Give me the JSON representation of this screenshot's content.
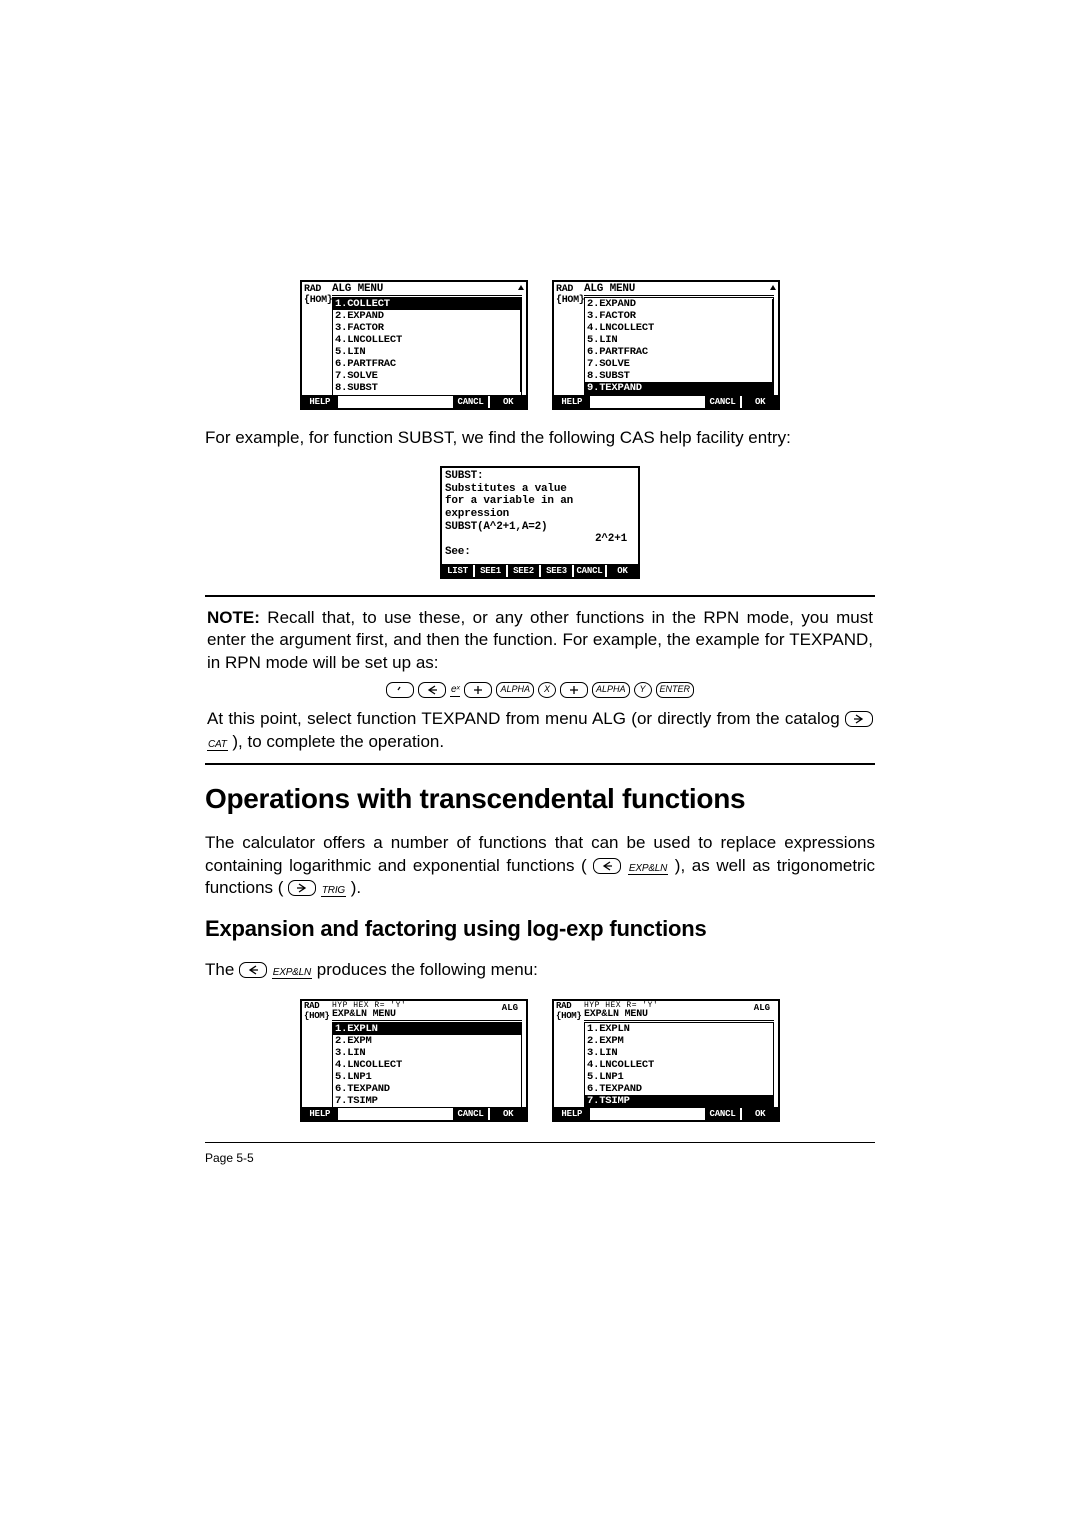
{
  "alg_menu_left": {
    "side": [
      "RAD",
      "{HOM}"
    ],
    "title": "ALG MENU",
    "items": [
      "1.COLLECT",
      "2.EXPAND",
      "3.FACTOR",
      "4.LNCOLLECT",
      "5.LIN",
      "6.PARTFRAC",
      "7.SOLVE",
      "8.SUBST"
    ],
    "selected_index": 0,
    "softkeys": [
      "HELP",
      "",
      "",
      "",
      "CANCL",
      "OK"
    ]
  },
  "alg_menu_right": {
    "side": [
      "RAD",
      "{HOM}"
    ],
    "title": "ALG MENU",
    "items": [
      "2.EXPAND",
      "3.FACTOR",
      "4.LNCOLLECT",
      "5.LIN",
      "6.PARTFRAC",
      "7.SOLVE",
      "8.SUBST",
      "9.TEXPAND"
    ],
    "selected_index": 7,
    "softkeys": [
      "HELP",
      "",
      "",
      "",
      "CANCL",
      "OK"
    ]
  },
  "para_example": "For example, for function SUBST, we find the following CAS help facility entry:",
  "subst_help": {
    "lines": [
      "SUBST:",
      "Substitutes a value",
      "for a variable in an",
      "expression",
      "SUBST(A^2+1,A=2)"
    ],
    "result": "2^2+1",
    "see": "See:",
    "softkeys": [
      "LIST",
      "SEE1",
      "SEE2",
      "SEE3",
      "CANCL",
      "OK"
    ]
  },
  "note": {
    "label": "NOTE:",
    "para1": " Recall that, to use these, or any other functions in the RPN mode, you must enter the argument first, and then the function. For example, the example for TEXPAND, in RPN mode will be set up as:",
    "keyrow": [
      {
        "type": "cap",
        "glyph": "tick"
      },
      {
        "type": "cap",
        "glyph": "left"
      },
      {
        "type": "label",
        "text": "eˣ"
      },
      {
        "type": "cap",
        "glyph": "plus"
      },
      {
        "type": "cap",
        "text": "ALPHA"
      },
      {
        "type": "cap",
        "text": "X",
        "round": true
      },
      {
        "type": "cap",
        "glyph": "plus"
      },
      {
        "type": "cap",
        "text": "ALPHA"
      },
      {
        "type": "cap",
        "text": "Y",
        "round": true
      },
      {
        "type": "cap",
        "text": "ENTER"
      }
    ],
    "para2a": "At this point, select function TEXPAND from menu ALG (or directly from the catalog ",
    "cat_key": {
      "cap_glyph": "right",
      "label": "CAT"
    },
    "para2b": " ), to complete the operation."
  },
  "section_title": "Operations with transcendental functions",
  "section_body_a": "The calculator offers a number of functions that can be used to replace expressions containing logarithmic and exponential functions ( ",
  "expln_key": {
    "cap_glyph": "left",
    "label": "EXP&LN"
  },
  "section_body_b": " ), as well as trigonometric functions ( ",
  "trig_key": {
    "cap_glyph": "right",
    "label": "TRIG"
  },
  "section_body_c": " ).",
  "subsection_title": "Expansion and factoring using log-exp functions",
  "subsection_body_a": "The ",
  "subsection_body_b": "  produces the following menu:",
  "expln_menu_left": {
    "side": [
      "RAD",
      "{HOM}"
    ],
    "preline": "HYP HEX R= 'Y'",
    "title": "EXP&LN MENU",
    "items": [
      "1.EXPLN",
      "2.EXPM",
      "3.LIN",
      "4.LNCOLLECT",
      "5.LNP1",
      "6.TEXPAND",
      "7.TSIMP"
    ],
    "selected_index": 0,
    "softkeys": [
      "HELP",
      "",
      "",
      "",
      "CANCL",
      "OK"
    ],
    "ring": "ALG"
  },
  "expln_menu_right": {
    "side": [
      "RAD",
      "{HOM}"
    ],
    "preline": "HYP HEX R= 'Y'",
    "title": "EXP&LN MENU",
    "items": [
      "1.EXPLN",
      "2.EXPM",
      "3.LIN",
      "4.LNCOLLECT",
      "5.LNP1",
      "6.TEXPAND",
      "7.TSIMP"
    ],
    "selected_index": 6,
    "softkeys": [
      "HELP",
      "",
      "",
      "",
      "CANCL",
      "OK"
    ],
    "ring": "ALG"
  },
  "page_number": "Page 5-5"
}
